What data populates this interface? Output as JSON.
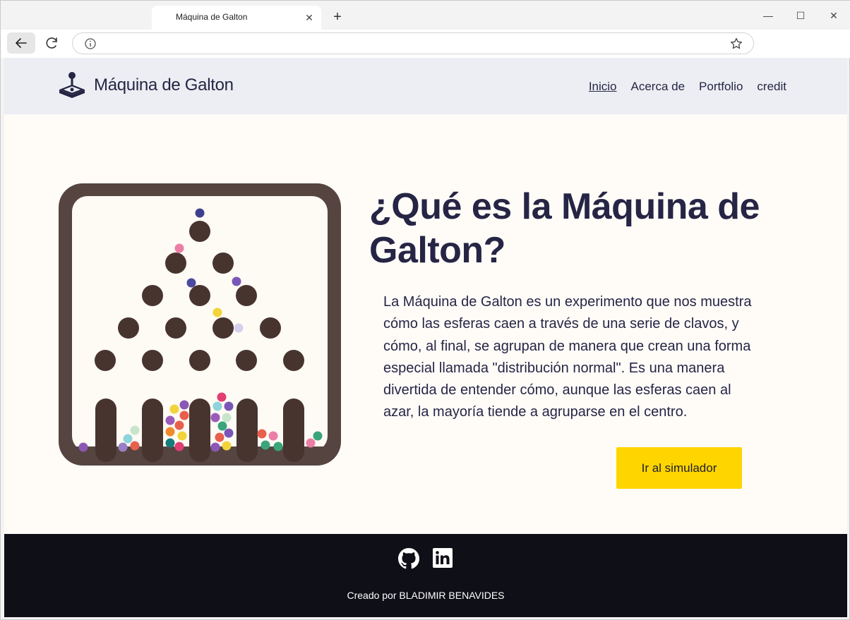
{
  "browser": {
    "tab_title": "Máquina de Galton",
    "tab_close": "✕",
    "new_tab": "+",
    "minimize": "—",
    "maximize": "☐",
    "close": "✕"
  },
  "header": {
    "site_title": "Máquina de Galton",
    "logo_icon": "joystick-icon",
    "nav": [
      {
        "label": "Inicio",
        "active": true
      },
      {
        "label": "Acerca de",
        "active": false
      },
      {
        "label": "Portfolio",
        "active": false
      },
      {
        "label": "credit",
        "active": false
      }
    ]
  },
  "hero": {
    "title": "¿Qué es la Máquina de Galton?",
    "description": "La Máquina de Galton es un experimento que nos muestra cómo las esferas caen a través de una serie de clavos, y cómo, al final, se agrupan de manera que crean una forma especial llamada \"distribución normal\". Es una manera divertida de entender cómo, aunque las esferas caen al azar, la mayoría tiende a agruparse en el centro.",
    "button_label": "Ir al simulador",
    "illustration": "galton-board-illustration"
  },
  "footer": {
    "icons": [
      "github-icon",
      "linkedin-icon"
    ],
    "credit": "Creado por BLADIMIR BENAVIDES"
  },
  "colors": {
    "header_bg": "#eceef3",
    "page_bg": "#fffcf8",
    "text": "#262545",
    "button": "#ffd500",
    "footer_bg": "#0f0f17",
    "board_frame": "#554440",
    "peg": "#47342f"
  }
}
